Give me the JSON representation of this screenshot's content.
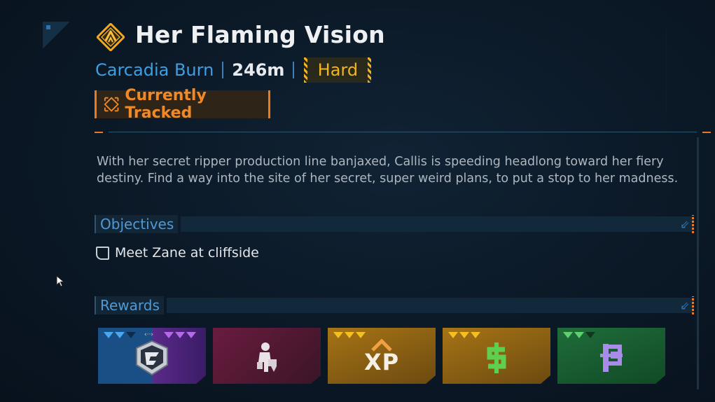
{
  "mission": {
    "title": "Her Flaming Vision",
    "location": "Carcadia Burn",
    "distance": "246m",
    "difficulty": "Hard",
    "tracked_label": "Currently Tracked",
    "description": "With her secret ripper production line banjaxed, Callis is speeding headlong toward her fiery destiny. Find a way into the site of her secret, super weird plans, to put a stop to her madness."
  },
  "objectives": {
    "header": "Objectives",
    "items": [
      {
        "text": "Meet Zane at cliffside",
        "completed": false
      }
    ]
  },
  "rewards": {
    "header": "Rewards",
    "items": [
      {
        "icon": "vault-hunter-emblem-icon",
        "colors": [
          "#1a4f86",
          "#5a2a8a"
        ]
      },
      {
        "icon": "character-cosmetic-icon",
        "colors": [
          "#6a1c3e"
        ]
      },
      {
        "icon": "xp-icon",
        "label": "XP",
        "colors": [
          "#a77416"
        ]
      },
      {
        "icon": "cash-icon",
        "colors": [
          "#a77416"
        ]
      },
      {
        "icon": "eridium-icon",
        "colors": [
          "#1f6d3a"
        ]
      }
    ]
  },
  "colors": {
    "accent_orange": "#f07a1a",
    "accent_blue": "#3d9fe4",
    "difficulty_yellow": "#f2b420"
  }
}
